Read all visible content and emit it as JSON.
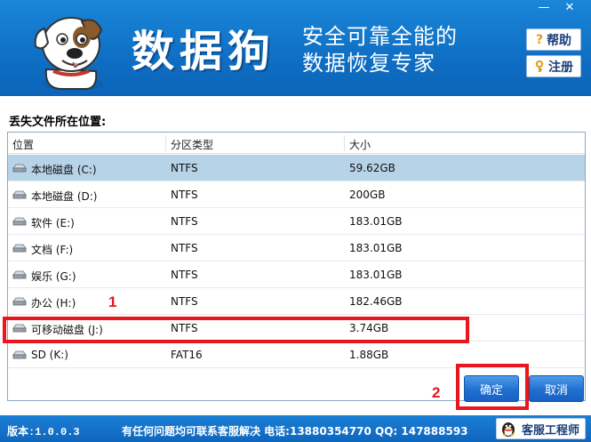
{
  "window": {
    "minimize_glyph": "—",
    "close_glyph": "✕"
  },
  "header": {
    "brand": "数据狗",
    "slogan_line1": "安全可靠全能的",
    "slogan_line2": "数据恢复专家",
    "help_label": "帮助",
    "register_label": "注册",
    "help_icon": "?",
    "register_icon": "key-icon"
  },
  "list": {
    "prompt": "丢失文件所在位置:",
    "columns": [
      "位置",
      "分区类型",
      "大小"
    ],
    "rows": [
      {
        "name": "本地磁盘 (C:)",
        "type": "NTFS",
        "size": "59.62GB",
        "selected": true
      },
      {
        "name": "本地磁盘 (D:)",
        "type": "NTFS",
        "size": "200GB",
        "selected": false
      },
      {
        "name": "软件 (E:)",
        "type": "NTFS",
        "size": "183.01GB",
        "selected": false
      },
      {
        "name": "文档 (F:)",
        "type": "NTFS",
        "size": "183.01GB",
        "selected": false
      },
      {
        "name": "娱乐 (G:)",
        "type": "NTFS",
        "size": "183.01GB",
        "selected": false
      },
      {
        "name": "办公 (H:)",
        "type": "NTFS",
        "size": "182.46GB",
        "selected": false
      },
      {
        "name": "可移动磁盘 (J:)",
        "type": "NTFS",
        "size": "3.74GB",
        "selected": false
      },
      {
        "name": "SD (K:)",
        "type": "FAT16",
        "size": "1.88GB",
        "selected": false
      }
    ]
  },
  "annotations": {
    "marker1": "1",
    "marker2": "2",
    "highlight_color": "#e8161d"
  },
  "buttons": {
    "ok": "确定",
    "cancel": "取消"
  },
  "footer": {
    "version": "版本:1.0.0.3",
    "message": "有任何问题均可联系客服解决 电话:13880354770 QQ: 147888593",
    "support_label": "客服工程师"
  },
  "colors": {
    "header_blue": "#1a86d8",
    "selected_row": "#b7d3e8",
    "button_blue": "#1f6fd0"
  }
}
